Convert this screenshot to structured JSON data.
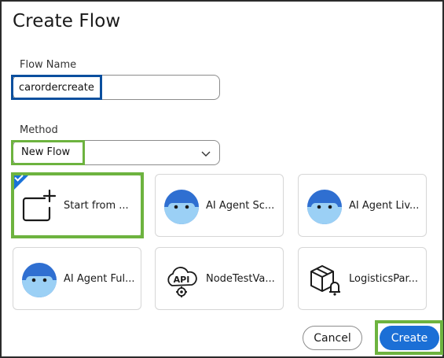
{
  "dialog": {
    "title": "Create Flow"
  },
  "flow_name": {
    "label": "Flow Name",
    "value": "carordercreate"
  },
  "method": {
    "label": "Method",
    "selected": "New Flow"
  },
  "templates": [
    {
      "name": "Start from ...",
      "icon": "blank-canvas-plus-icon",
      "selected": true
    },
    {
      "name": "AI Agent Sc...",
      "icon": "ai-agent-icon",
      "selected": false
    },
    {
      "name": "AI Agent Liv...",
      "icon": "ai-agent-icon",
      "selected": false
    },
    {
      "name": "AI Agent Ful...",
      "icon": "ai-agent-icon",
      "selected": false
    },
    {
      "name": "NodeTestVa...",
      "icon": "api-cloud-gear-icon",
      "selected": false
    },
    {
      "name": "LogisticsPar...",
      "icon": "box-bell-icon",
      "selected": false
    }
  ],
  "actions": {
    "cancel_label": "Cancel",
    "create_label": "Create"
  },
  "colors": {
    "primary": "#1b6fd6",
    "highlight_green": "#6db33f",
    "highlight_blue": "#0b4f9e",
    "agent_blue": "#2f6fd1",
    "agent_face": "#9bd0f5"
  }
}
